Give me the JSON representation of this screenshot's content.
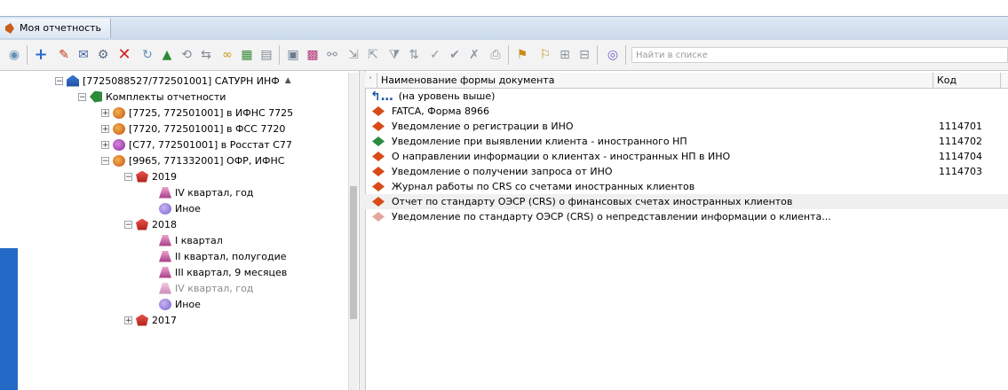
{
  "window": {
    "tab_title": "Моя отчетность"
  },
  "toolbar": {
    "search_placeholder": "Найти в списке"
  },
  "tree": {
    "items": [
      {
        "label": "[7725088527/772501001] САТУРН ИНФ"
      },
      {
        "label": "Комплекты отчетности"
      },
      {
        "label": "[7725, 772501001] в ИФНС 7725"
      },
      {
        "label": "[7720, 772501001] в ФСС 7720"
      },
      {
        "label": "[С77, 772501001] в Росстат С77"
      },
      {
        "label": "[9965, 771332001] ОФР, ИФНС"
      },
      {
        "label": "2019"
      },
      {
        "label": "IV квартал, год"
      },
      {
        "label": "Иное"
      },
      {
        "label": "2018"
      },
      {
        "label": "I квартал"
      },
      {
        "label": "II квартал, полугодие"
      },
      {
        "label": "III квартал, 9 месяцев"
      },
      {
        "label": "IV квартал, год"
      },
      {
        "label": "Иное"
      },
      {
        "label": "2017"
      }
    ]
  },
  "grid": {
    "headers": {
      "name": "Наименование формы документа",
      "code": "Код"
    },
    "up_label": "(на уровень выше)",
    "rows": [
      {
        "name": "FATCA, Форма 8966",
        "code": ""
      },
      {
        "name": "Уведомление о регистрации в ИНО",
        "code": "1114701"
      },
      {
        "name": "Уведомление при выявлении клиента - иностранного НП",
        "code": "1114702"
      },
      {
        "name": "О направлении информации о клиентах - иностранных НП в ИНО",
        "code": "1114704"
      },
      {
        "name": "Уведомление о получении запроса от ИНО",
        "code": "1114703"
      },
      {
        "name": "Журнал работы по CRS со счетами иностранных клиентов",
        "code": ""
      },
      {
        "name": "Отчет по стандарту ОЭСР (CRS) о финансовых счетах иностранных клиентов",
        "code": ""
      },
      {
        "name": "Уведомление по стандарту ОЭСР (CRS) о непредставлении информации о клиента...",
        "code": ""
      }
    ]
  }
}
